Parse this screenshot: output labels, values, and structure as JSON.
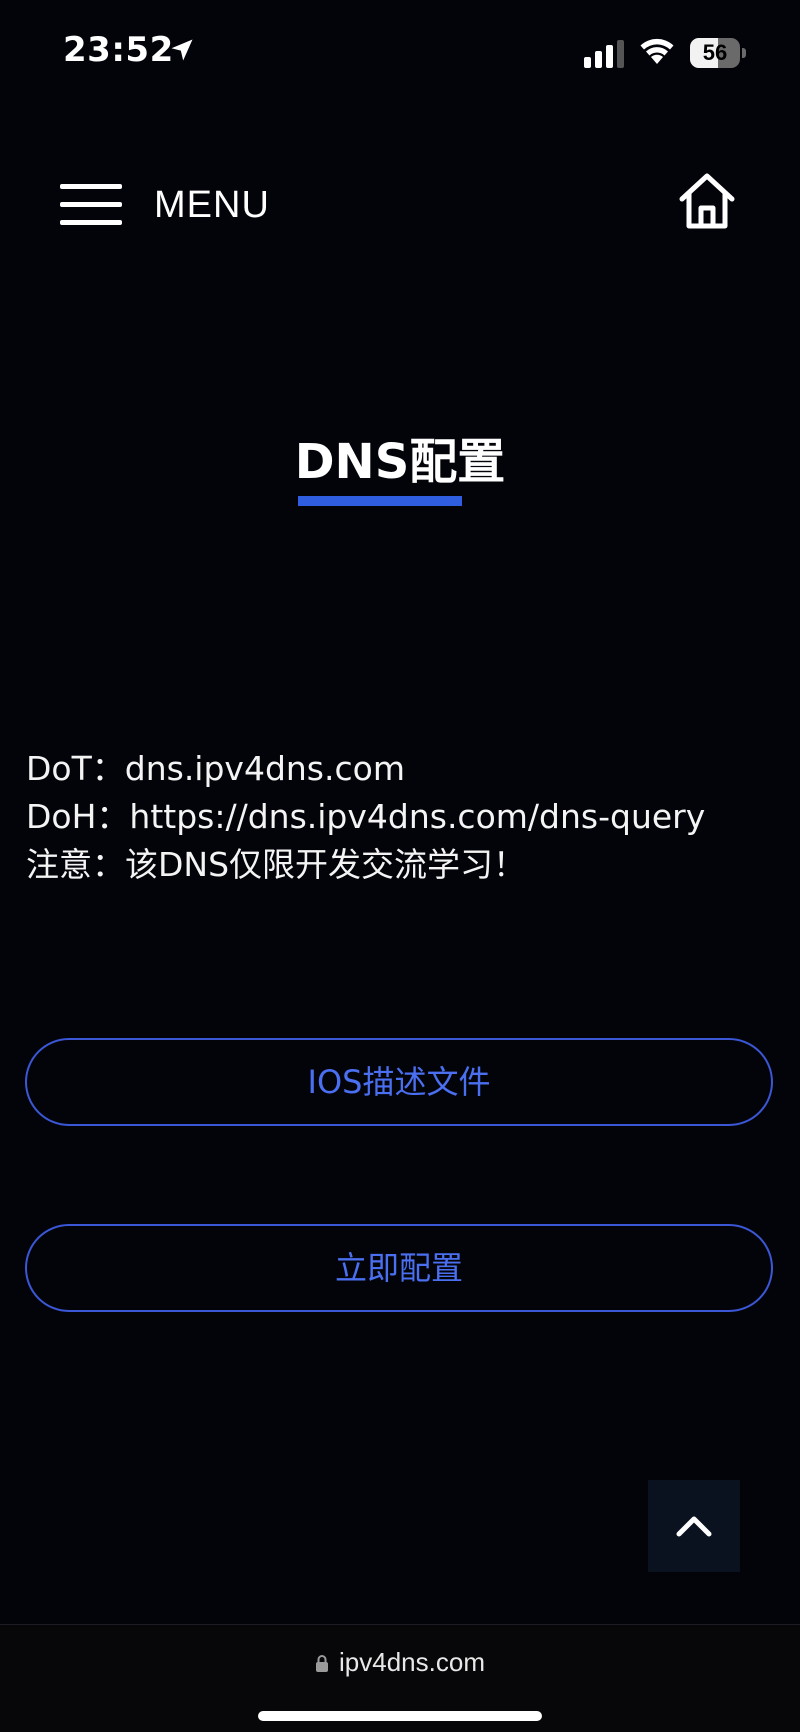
{
  "status_bar": {
    "time": "23:52",
    "battery_percent": "56",
    "battery_level": 0.56
  },
  "header": {
    "menu_label": "MENU"
  },
  "page": {
    "title": "DNS配置",
    "info_lines": [
      "DoT：dns.ipv4dns.com",
      "DoH：https://dns.ipv4dns.com/dns-query",
      "注意：该DNS仅限开发交流学习！"
    ]
  },
  "buttons": {
    "ios_profile": "IOS描述文件",
    "configure_now": "立即配置"
  },
  "browser": {
    "url": "ipv4dns.com"
  },
  "colors": {
    "background": "#03040a",
    "accent": "#2f5fe0",
    "button_text": "#4a6ff0",
    "button_border": "#3b57d6"
  },
  "icons": {
    "menu": "hamburger-icon",
    "home": "home-icon",
    "back_to_top": "chevron-up-icon",
    "lock": "lock-icon",
    "location": "location-arrow-icon",
    "signal": "cellular-signal-icon",
    "wifi": "wifi-icon",
    "battery": "battery-icon"
  }
}
